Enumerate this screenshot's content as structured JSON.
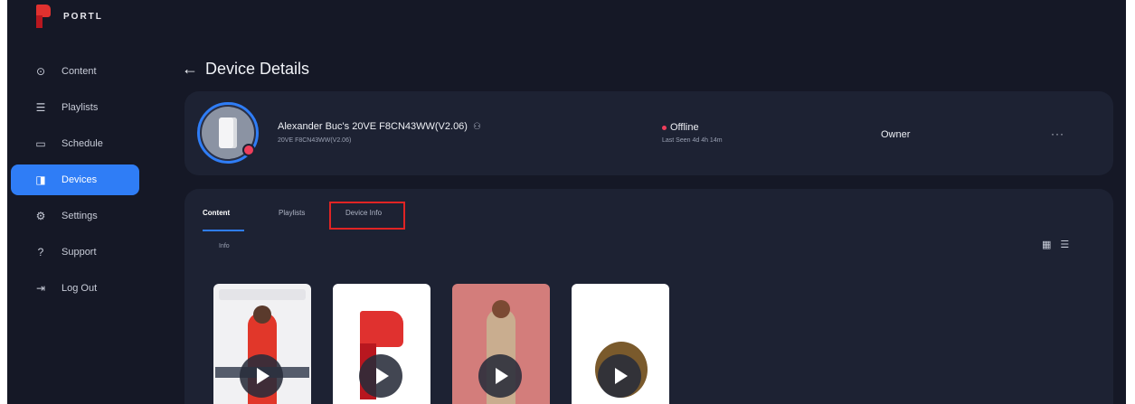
{
  "brand": {
    "name": "PORTL",
    "colors": {
      "primary": "#e0312f",
      "dark": "#b8171f"
    }
  },
  "sidebar": {
    "items": [
      {
        "label": "Content",
        "icon": "play-circle-icon",
        "active": false
      },
      {
        "label": "Playlists",
        "icon": "playlist-icon",
        "active": false
      },
      {
        "label": "Schedule",
        "icon": "calendar-icon",
        "active": false
      },
      {
        "label": "Devices",
        "icon": "device-icon",
        "active": true
      },
      {
        "label": "Settings",
        "icon": "gear-icon",
        "active": false
      },
      {
        "label": "Support",
        "icon": "help-icon",
        "active": false
      },
      {
        "label": "Log Out",
        "icon": "logout-icon",
        "active": false
      }
    ]
  },
  "page": {
    "back_arrow": "←",
    "title": "Device Details"
  },
  "device": {
    "name": "Alexander Buc's 20VE F8CN43WW(V2.06)",
    "subtitle": "20VE F8CN43WW(V2.06)",
    "status": "Offline",
    "last_seen": "Last Seen 4d 4h 14m",
    "role": "Owner",
    "more": "···",
    "status_color": "#ef3e5b"
  },
  "tabs": [
    {
      "label": "Content",
      "active": true
    },
    {
      "label": "Playlists",
      "active": false
    },
    {
      "label": "Device Info",
      "active": false,
      "highlighted": true
    }
  ],
  "content": {
    "info_label": "Info",
    "view_toggle": {
      "grid": "▦",
      "list": "☰"
    },
    "thumbnails": [
      {
        "name": "woman-red-dress"
      },
      {
        "name": "portl-logo"
      },
      {
        "name": "woman-trench-coat"
      },
      {
        "name": "lion"
      }
    ]
  },
  "accent": "#2f7df6"
}
